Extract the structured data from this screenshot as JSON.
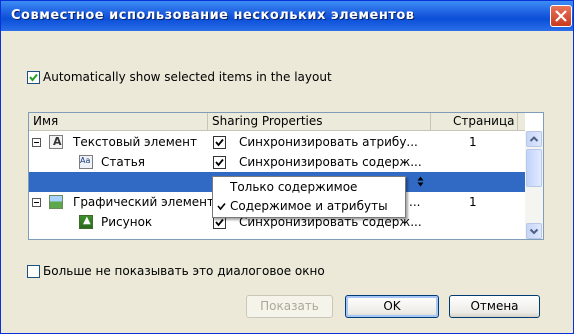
{
  "window": {
    "title": "Совместное использование нескольких элементов"
  },
  "options": {
    "auto_show": {
      "label": "Automatically show selected items in the layout",
      "checked": true
    },
    "dont_show_again": {
      "label": "Больше не показывать это диалоговое окно",
      "checked": false
    }
  },
  "grid": {
    "columns": {
      "name": "Имя",
      "sharing": "Sharing Properties",
      "page": "Страница"
    },
    "rows": [
      {
        "name": "Текстовый элемент",
        "sharing": "Синхронизировать атрибу...",
        "page": "1",
        "checked": true
      },
      {
        "name": "Статья",
        "sharing": "Синхронизировать содерж...",
        "page": "",
        "checked": true
      },
      {
        "name": "",
        "sharing": "",
        "page": "",
        "checked": false
      },
      {
        "name": "Графический элемент",
        "sharing": "...",
        "page": "1",
        "checked": true
      },
      {
        "name": "Рисунок",
        "sharing": "Синхронизировать содерж...",
        "page": "",
        "checked": true
      }
    ]
  },
  "menu": {
    "items": [
      {
        "label": "Только содержимое",
        "checked": false
      },
      {
        "label": "Содержимое и атрибуты",
        "checked": true
      }
    ]
  },
  "buttons": {
    "show": "Показать",
    "ok": "OK",
    "cancel": "Отмена"
  },
  "icons": {
    "text_frame": "A",
    "story": "Aa"
  },
  "colors": {
    "selection": "#316ac5",
    "titlebar": "#0a4fd8"
  }
}
